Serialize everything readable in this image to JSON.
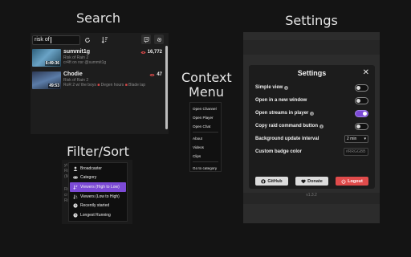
{
  "titles": {
    "search": "Search",
    "settings": "Settings",
    "context_menu_line1": "Context",
    "context_menu_line2": "Menu",
    "filter_sort": "Filter/Sort"
  },
  "search": {
    "query": "risk of",
    "streams": [
      {
        "name": "summit1g",
        "game": "Risk of Rain 2",
        "title": "cr4ft on nsr @summit1g",
        "duration": "6:49:36",
        "viewers": "16,772"
      },
      {
        "name": "Chodie",
        "game": "Risk of Rain 2",
        "title": "RoR 2 w/ the boys",
        "tags": [
          "Degen hours",
          "Blade lap"
        ],
        "duration": "49:53",
        "viewers": "47"
      }
    ]
  },
  "context_menu": {
    "items_group1": [
      "Open Channel",
      "Open Player",
      "Open Chat"
    ],
    "items_group2": [
      "About",
      "Videos",
      "Clips"
    ],
    "items_group3": [
      "Go to category"
    ]
  },
  "filter_sort": {
    "background_lines": [
      "yt",
      "Ri",
      "(M",
      "Ri",
      "cr",
      "Ri"
    ],
    "options": [
      {
        "label": "Broadcaster",
        "icon": "person-icon",
        "active": false
      },
      {
        "label": "Category",
        "icon": "gamepad-icon",
        "active": false
      },
      {
        "label": "Viewers (High to Low)",
        "icon": "sort-desc-icon",
        "active": true
      },
      {
        "label": "Viewers (Low to High)",
        "icon": "sort-asc-icon",
        "active": false
      },
      {
        "label": "Recently started",
        "icon": "clock-icon",
        "active": false
      },
      {
        "label": "Longest Running",
        "icon": "clock-icon",
        "active": false
      }
    ]
  },
  "settings": {
    "title": "Settings",
    "close_symbol": "✕",
    "rows": {
      "simple_view": {
        "label": "Simple view",
        "info": true,
        "on": false
      },
      "new_window": {
        "label": "Open in a new window",
        "info": false,
        "on": false
      },
      "streams_in_player": {
        "label": "Open streams in player",
        "info": true,
        "on": true
      },
      "raid_command": {
        "label": "Copy raid command button",
        "info": true,
        "on": false
      },
      "update_interval": {
        "label": "Background update interval",
        "value": "2 min"
      },
      "badge_color": {
        "label": "Custom badge color",
        "placeholder": "#RRGGBB"
      }
    },
    "buttons": {
      "github": "GitHub",
      "donate": "Donate",
      "logout": "Logout"
    },
    "version": "v1.3.2"
  },
  "colors": {
    "accent": "#7c4ad6",
    "live_red": "#e04b4b",
    "logout_red": "#e04b4b"
  }
}
